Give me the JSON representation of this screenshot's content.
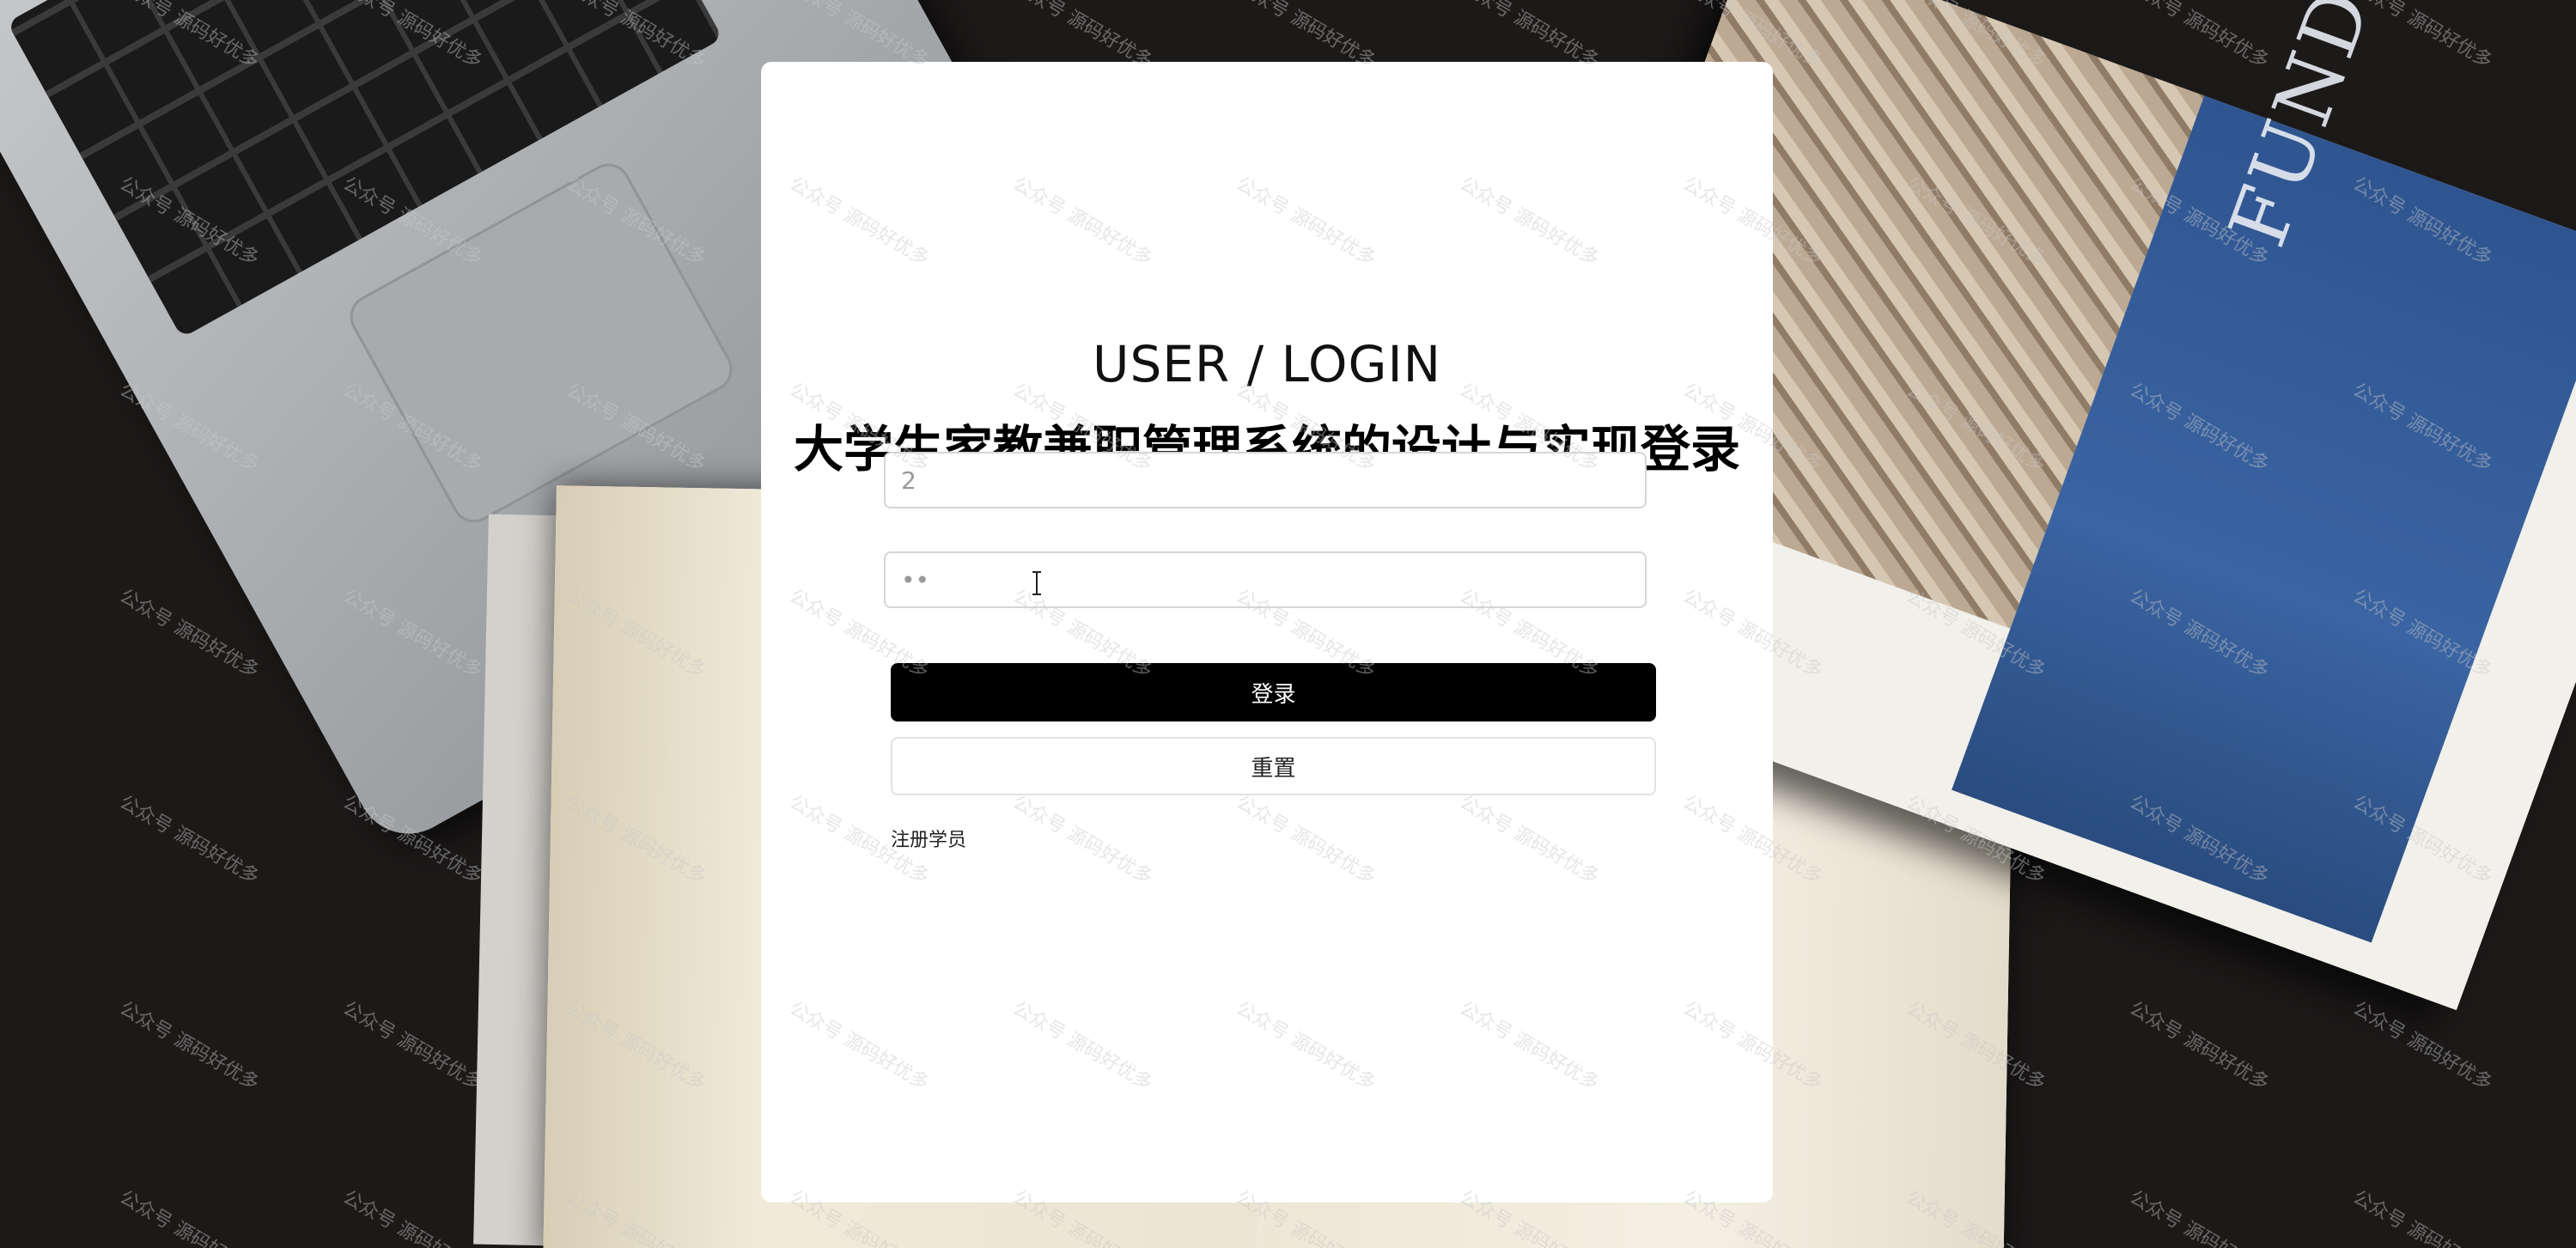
{
  "login": {
    "title_en": "USER / LOGIN",
    "title_cn": "大学生家教兼职管理系统的设计与实现登录",
    "username_value": "2",
    "password_value": "••",
    "login_button": "登录",
    "reset_button": "重置",
    "register_link": "注册学员"
  },
  "background": {
    "textbook_title": "FUNDAMENTALS",
    "watermark_text": "公众号 源码好优多"
  },
  "colors": {
    "card": "#ffffff",
    "login_button": "#000000",
    "background": "#1c1a19"
  }
}
